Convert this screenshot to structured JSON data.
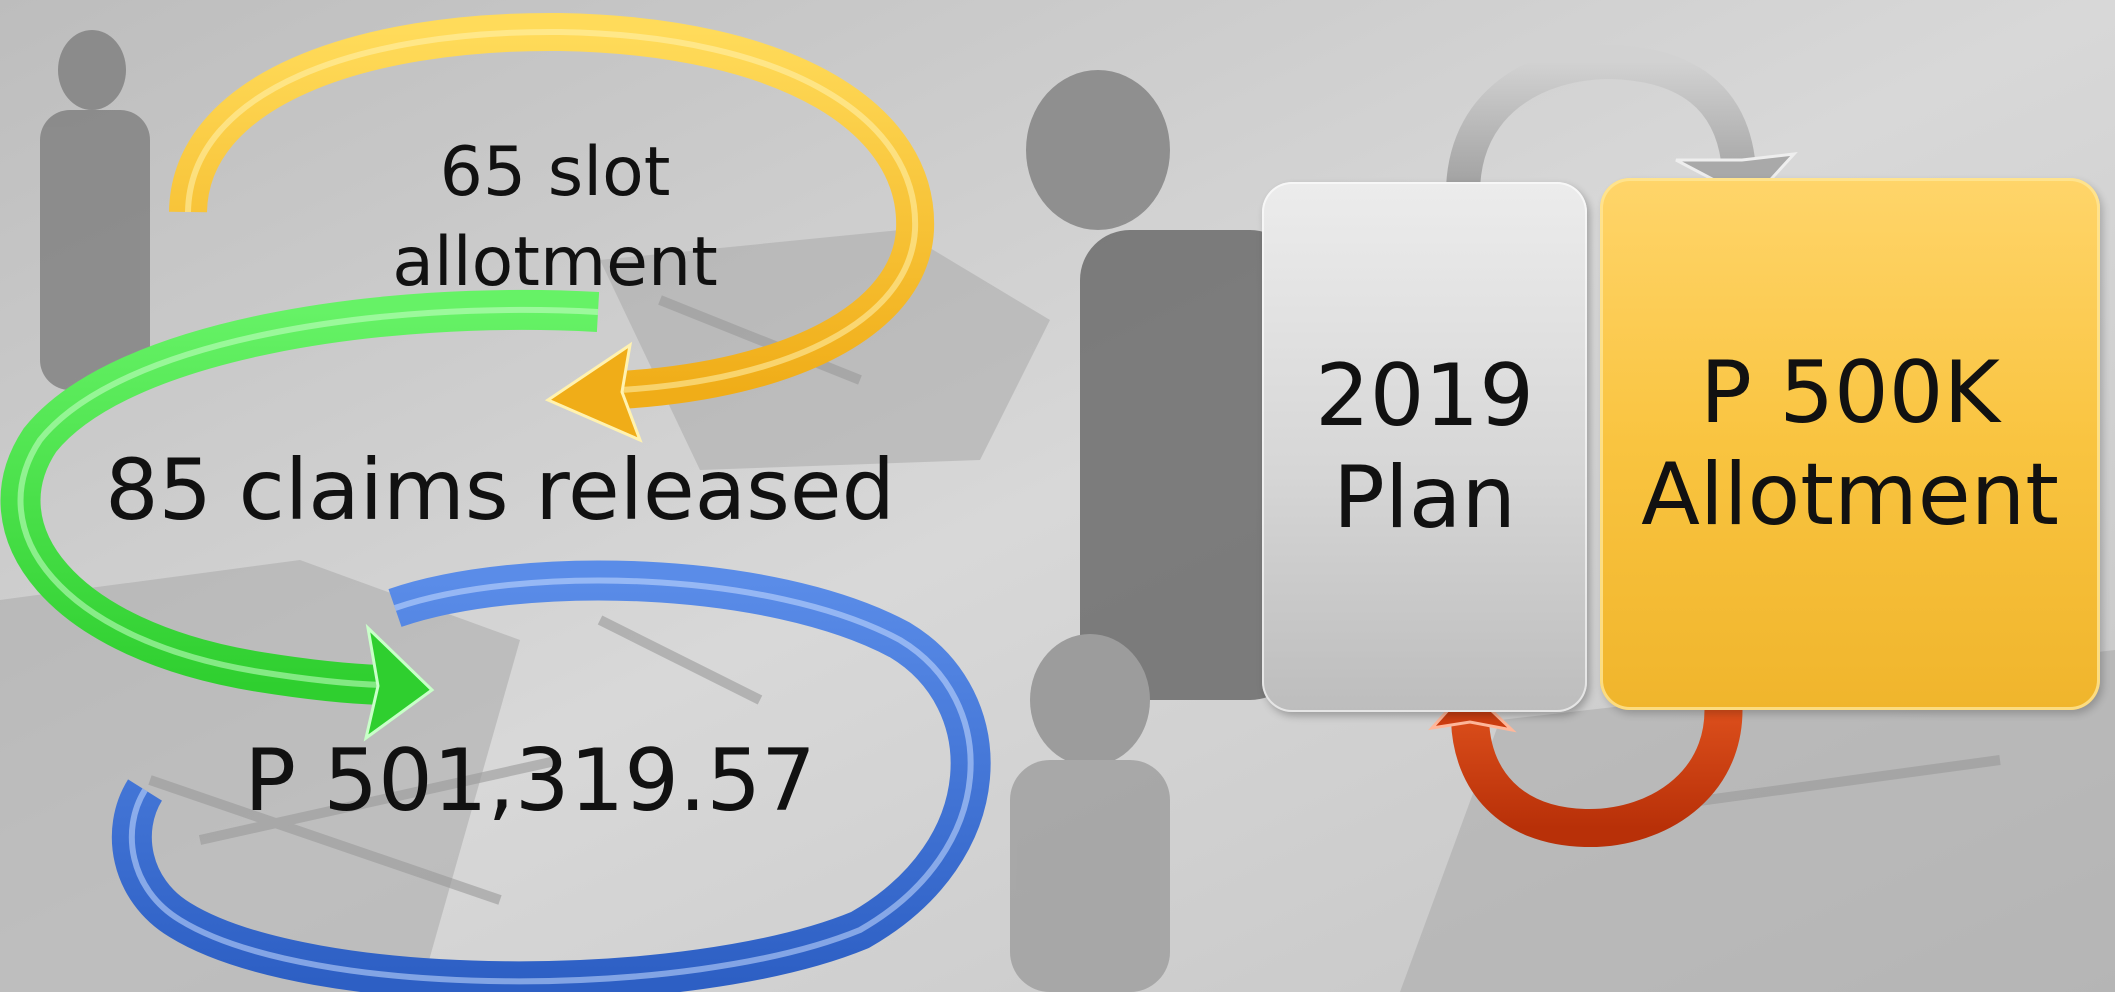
{
  "cycle_left": {
    "slot_line1": "65 slot",
    "slot_line2": "allotment",
    "claims": "85 claims released",
    "amount": "P 501,319.57",
    "colors": {
      "yellow": "#f7bf2a",
      "green": "#3ad93a",
      "blue": "#3a6fd4"
    }
  },
  "cycle_right": {
    "plan_line1": "2019",
    "plan_line2": "Plan",
    "allot_line1": "P 500K",
    "allot_line2": "Allotment",
    "colors": {
      "plan_box": "#d9d9d9",
      "allot_box": "#f9c440",
      "top_arrow": "#a9a9a9",
      "bottom_arrow": "#cc3d10"
    }
  }
}
